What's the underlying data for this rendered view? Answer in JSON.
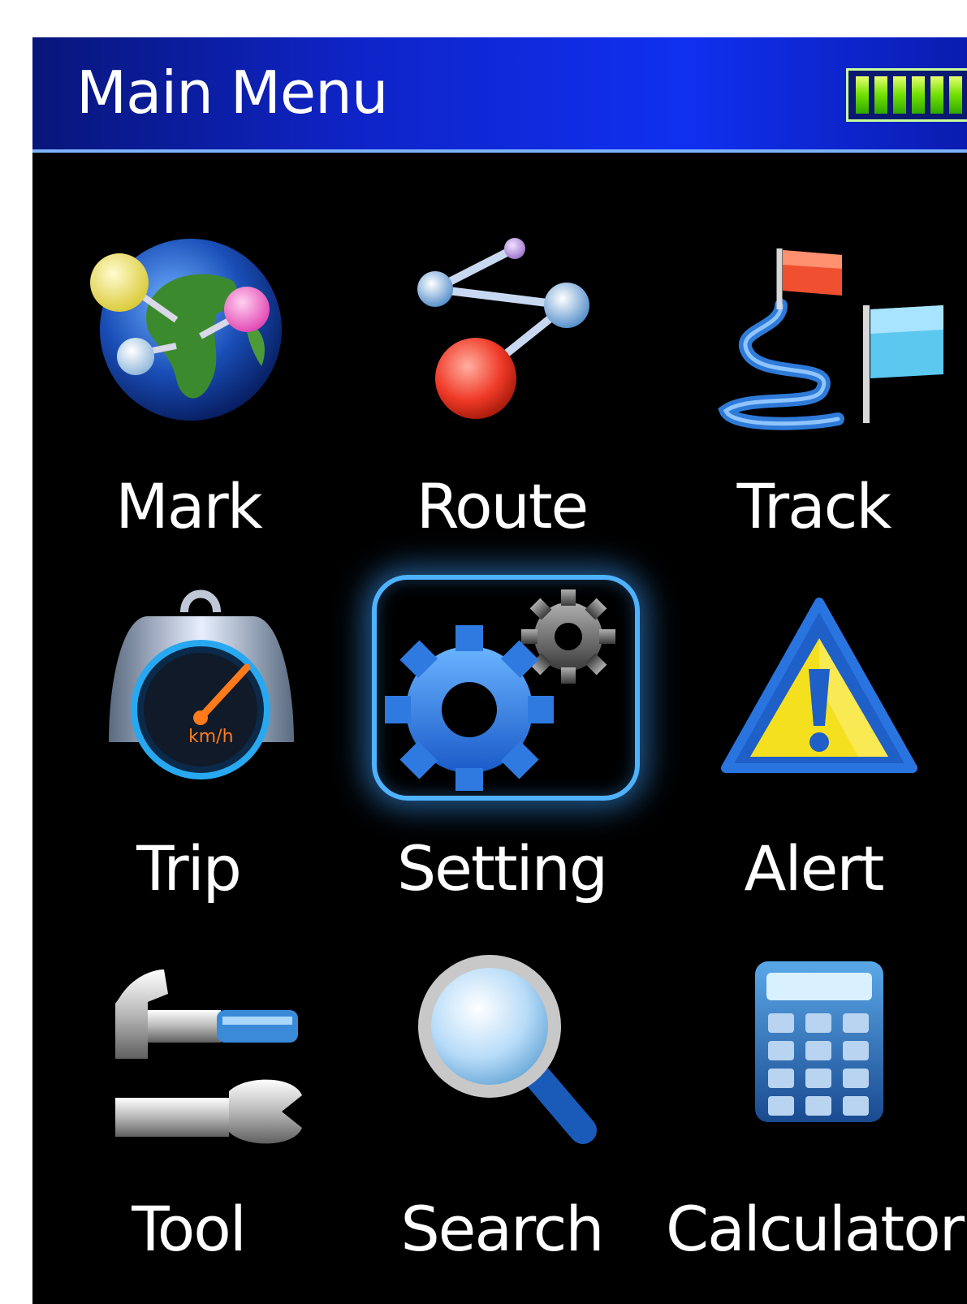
{
  "header": {
    "title": "Main Menu"
  },
  "battery": {
    "level": 1.0
  },
  "menu": {
    "items": [
      {
        "label": "Mark",
        "icon": "globe-pins-icon"
      },
      {
        "label": "Route",
        "icon": "route-nodes-icon"
      },
      {
        "label": "Track",
        "icon": "track-flags-icon"
      },
      {
        "label": "Trip",
        "icon": "speedometer-icon"
      },
      {
        "label": "Setting",
        "icon": "gears-icon"
      },
      {
        "label": "Alert",
        "icon": "warning-icon"
      },
      {
        "label": "Tool",
        "icon": "hammer-wrench-icon"
      },
      {
        "label": "Search",
        "icon": "magnifier-icon"
      },
      {
        "label": "Calculator",
        "icon": "calculator-icon"
      }
    ],
    "selected": "Setting"
  },
  "colors": {
    "title_bar": "#1030f0",
    "background": "#000000",
    "selection_glow": "#4fb2ff",
    "battery_fill": "#6fe000"
  }
}
